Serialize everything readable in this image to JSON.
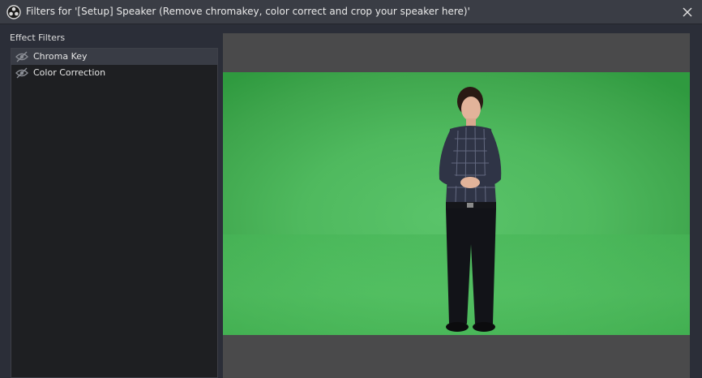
{
  "window": {
    "title": "Filters for '[Setup] Speaker (Remove chromakey, color correct and crop your speaker here)'",
    "app_icon": "obs-logo-icon",
    "close_icon": "close-icon"
  },
  "filters": {
    "section_label": "Effect Filters",
    "items": [
      {
        "label": "Chroma Key",
        "icon": "eye-hidden-icon",
        "selected": true
      },
      {
        "label": "Color Correction",
        "icon": "eye-hidden-icon",
        "selected": false
      }
    ]
  },
  "preview": {
    "description_icon": "speaker-on-green-screen",
    "colors": {
      "green_screen": "#4fb95e",
      "preview_bg": "#4a4a4b"
    }
  },
  "colors": {
    "window_bg": "#2b2e38",
    "titlebar_bg": "#3a3d45",
    "list_bg": "#1e1f22",
    "selected_bg": "#393c45"
  }
}
